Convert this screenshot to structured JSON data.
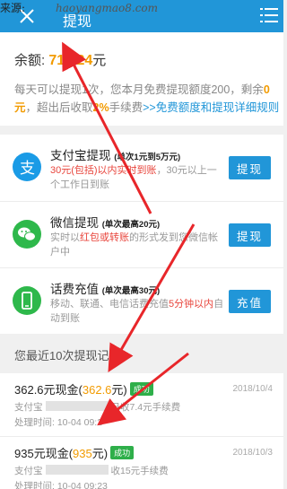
{
  "header": {
    "watermark": "来源:",
    "watermark_url": "haoyangmao8.com",
    "title": "提现",
    "back_icon": "close-x-icon",
    "menu_icon": "list-menu-icon"
  },
  "balance": {
    "label": "余额:",
    "amount": "714.24",
    "unit": "元",
    "note_part1": "每天可以提现1次，您本月免费提现额度200，剩余",
    "note_remaining": "0元",
    "note_part2": "，超出后收取",
    "note_fee": "2%",
    "note_part3": "手续费",
    "note_link": ">>免费额度和提现详细规则"
  },
  "methods": [
    {
      "icon": "alipay-icon",
      "title": "支付宝提现",
      "limit": "(单次1元到5万元)",
      "desc_red": "30元(包括)以内实时到账",
      "desc_rest": "，30元以上一个工作日到账",
      "button": "提现"
    },
    {
      "icon": "wechat-icon",
      "title": "微信提现",
      "limit": "(单次最高20元)",
      "desc_pre": "实时以",
      "desc_red": "红包或转账",
      "desc_rest": "的形式发到您微信帐户中",
      "button": "提现"
    },
    {
      "icon": "phone-recharge-icon",
      "title": "话费充值",
      "limit": "(单次最高30元)",
      "desc_pre": "移动、联通、电信话费充值",
      "desc_red": "5分钟以内",
      "desc_rest": "自动到账",
      "button": "充值"
    }
  ],
  "history": {
    "title": "您最近10次提现记录",
    "records": [
      {
        "title_pre": "362.6元现金(",
        "amount": "362.6",
        "title_post": "元)",
        "status": "成功",
        "date": "2018/10/4",
        "line1_pre": "支付宝",
        "line1_post": "已收7.4元手续费",
        "line2": "处理时间: 10-04 09:2"
      },
      {
        "title_pre": "935元现金(",
        "amount": "935",
        "title_post": "元)",
        "status": "成功",
        "date": "2018/10/3",
        "line1_pre": "支付宝",
        "line1_post": "收15元手续费",
        "line2": "处理时间: 10-04 09:23"
      }
    ]
  },
  "colors": {
    "primary": "#2196d8",
    "accent": "#f29b00",
    "alert": "#e8453c",
    "success": "#2eaf4a"
  }
}
